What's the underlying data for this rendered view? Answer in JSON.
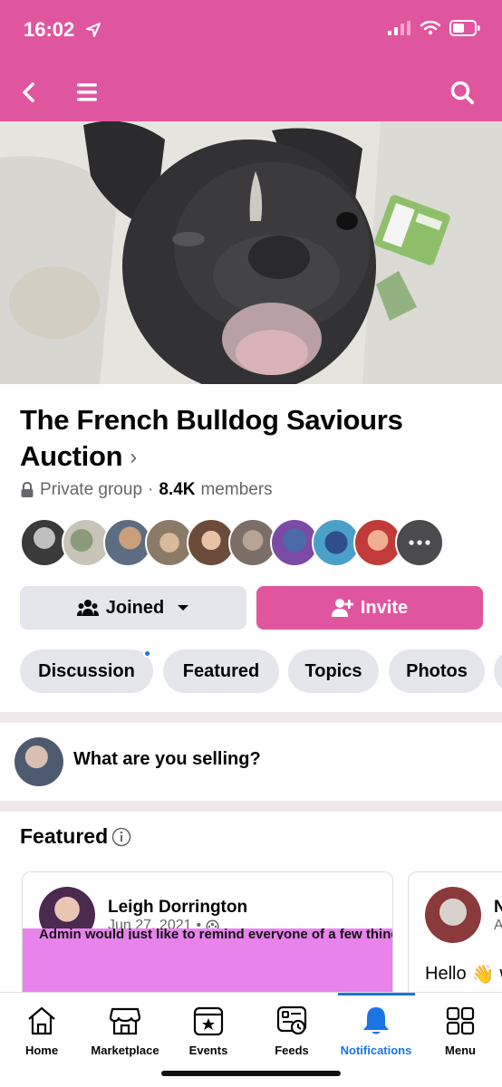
{
  "status": {
    "time": "16:02"
  },
  "header": {
    "back_icon": "back-chevron-icon",
    "menu_icon": "hamburger-icon",
    "search_icon": "search-icon",
    "color": "#e0569e"
  },
  "group": {
    "title": "The French Bulldog Saviours Auction",
    "privacy": "Private group",
    "dot": "·",
    "member_count": "8.4K",
    "members_label": "members"
  },
  "actions": {
    "joined_label": "Joined",
    "invite_label": "Invite"
  },
  "tabs": [
    {
      "label": "Discussion",
      "has_dot": true
    },
    {
      "label": "Featured"
    },
    {
      "label": "Topics"
    },
    {
      "label": "Photos"
    }
  ],
  "composer": {
    "placeholder": "What are you selling?"
  },
  "featured": {
    "heading": "Featured",
    "cards": [
      {
        "author": "Leigh Dorrington",
        "date": "Jun 27, 2021",
        "dot": "•",
        "banner_text": "Admin would just like to remind everyone of a few things:"
      },
      {
        "author": "N",
        "date": "A",
        "preview": "Hello",
        "preview_tail": "w"
      }
    ]
  },
  "tabbar": [
    {
      "label": "Home",
      "icon": "home-icon"
    },
    {
      "label": "Marketplace",
      "icon": "marketplace-icon"
    },
    {
      "label": "Events",
      "icon": "events-icon"
    },
    {
      "label": "Feeds",
      "icon": "feeds-icon"
    },
    {
      "label": "Notifications",
      "icon": "bell-icon",
      "active": true
    },
    {
      "label": "Menu",
      "icon": "grid-menu-icon"
    }
  ],
  "colors": {
    "accent": "#e0569e",
    "active": "#1b74e4",
    "banner": "#e883ec"
  }
}
